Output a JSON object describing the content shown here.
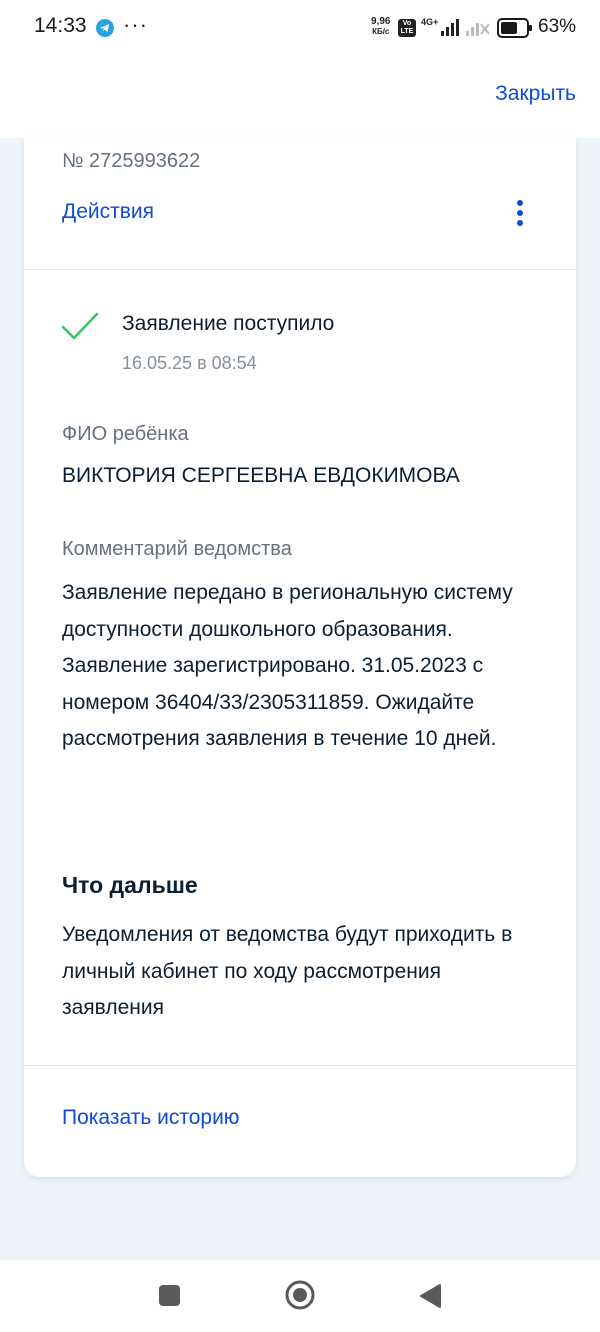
{
  "status_bar": {
    "time": "14:33",
    "dots": "···",
    "net_speed_value": "9,96",
    "net_speed_unit": "КБ/с",
    "volte": "Vo LTE",
    "network": "4G+",
    "battery_pct": "63%"
  },
  "header": {
    "close_label": "Закрыть"
  },
  "card": {
    "app_number": "№ 2725993622",
    "actions_label": "Действия",
    "status": {
      "title": "Заявление поступило",
      "date": "16.05.25 в 08:54",
      "color": "#34c759"
    },
    "child_label": "ФИО ребёнка",
    "child_name": "ВИКТОРИЯ СЕРГЕЕВНА ЕВДОКИМОВА",
    "comment_label": "Комментарий ведомства",
    "comment_text": "Заявление передано в региональную систему доступности дошкольного образования. Заявление зарегистрировано. 31.05.2023 с номером 36404/33/2305311859. Ожидайте рассмотрения заявления в течение 10 дней.",
    "next_heading": "Что дальше",
    "next_text": "Уведомления от ведомства будут приходить в личный кабинет по ходу рассмотрения заявления",
    "history_label": "Показать историю"
  },
  "colors": {
    "accent": "#0d4cd3",
    "background": "#eef2f9"
  },
  "icons": [
    "telegram-icon",
    "more-vert-icon",
    "check-icon",
    "recents-icon",
    "home-icon",
    "back-icon"
  ]
}
